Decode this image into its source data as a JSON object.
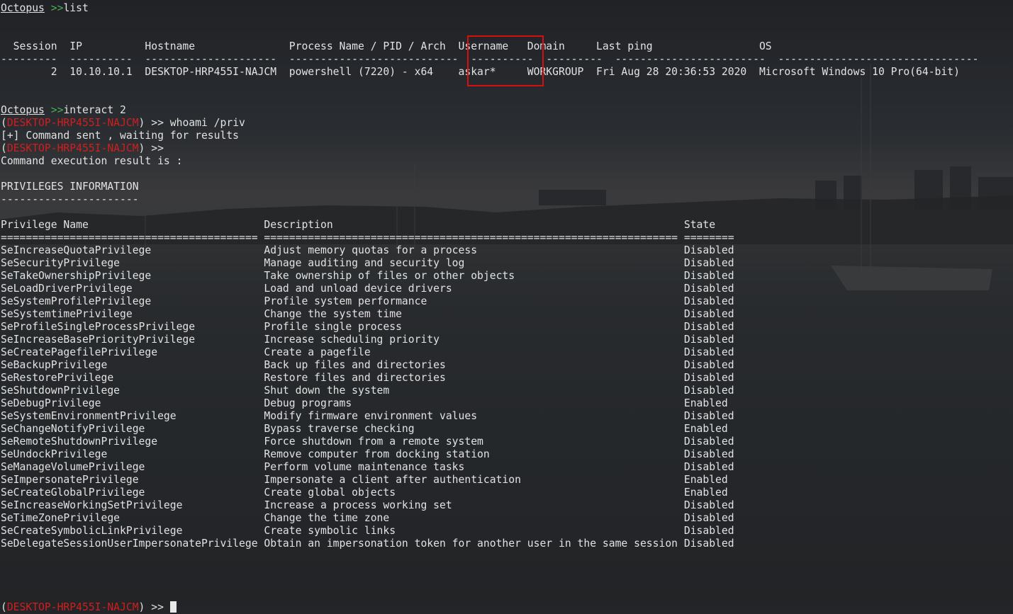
{
  "prompt": {
    "app": "Octopus",
    "arrows": ">>",
    "agent_host": "DESKTOP-HRP455I-NAJCM",
    "agent_arrows": ">>"
  },
  "commands": {
    "list": "list",
    "interact": "interact 2",
    "whoami": "whoami /priv"
  },
  "session_table": {
    "header_line": "  Session  IP          Hostname               Process Name / PID / Arch  Username   Domain     Last ping                 OS",
    "separator_line": "---------  ----------  ---------------------  ---------------------------  ----------  ---------  ------------------------  --------------------------------",
    "row_line": "        2  10.10.10.1  DESKTOP-HRP455I-NAJCM  powershell (7220) - x64    askar*     WORKGROUP  Fri Aug 28 20:36:53 2020  Microsoft Windows 10 Pro(64-bit)"
  },
  "messages": {
    "sent": "[+] Command sent , waiting for results",
    "result": "Command execution result is :"
  },
  "privileges": {
    "heading": "PRIVILEGES INFORMATION",
    "heading_rule": "----------------------",
    "col_header_line": "Privilege Name                            Description                                                        State",
    "eq_rule_line": "========================================= ================================================================== ========",
    "rows": [
      "SeIncreaseQuotaPrivilege                  Adjust memory quotas for a process                                 Disabled",
      "SeSecurityPrivilege                       Manage auditing and security log                                   Disabled",
      "SeTakeOwnershipPrivilege                  Take ownership of files or other objects                           Disabled",
      "SeLoadDriverPrivilege                     Load and unload device drivers                                     Disabled",
      "SeSystemProfilePrivilege                  Profile system performance                                         Disabled",
      "SeSystemtimePrivilege                     Change the system time                                             Disabled",
      "SeProfileSingleProcessPrivilege           Profile single process                                             Disabled",
      "SeIncreaseBasePriorityPrivilege           Increase scheduling priority                                       Disabled",
      "SeCreatePagefilePrivilege                 Create a pagefile                                                  Disabled",
      "SeBackupPrivilege                         Back up files and directories                                      Disabled",
      "SeRestorePrivilege                        Restore files and directories                                      Disabled",
      "SeShutdownPrivilege                       Shut down the system                                               Disabled",
      "SeDebugPrivilege                          Debug programs                                                     Enabled",
      "SeSystemEnvironmentPrivilege              Modify firmware environment values                                 Disabled",
      "SeChangeNotifyPrivilege                   Bypass traverse checking                                           Enabled",
      "SeRemoteShutdownPrivilege                 Force shutdown from a remote system                                Disabled",
      "SeUndockPrivilege                         Remove computer from docking station                               Disabled",
      "SeManageVolumePrivilege                   Perform volume maintenance tasks                                   Disabled",
      "SeImpersonatePrivilege                    Impersonate a client after authentication                          Enabled",
      "SeCreateGlobalPrivilege                   Create global objects                                              Enabled",
      "SeIncreaseWorkingSetPrivilege             Increase a process working set                                     Disabled",
      "SeTimeZonePrivilege                       Change the time zone                                               Disabled",
      "SeCreateSymbolicLinkPrivilege             Create symbolic links                                              Disabled",
      "SeDelegateSessionUserImpersonatePrivilege Obtain an impersonation token for another user in the same session Disabled"
    ]
  },
  "colors": {
    "background": "#232529",
    "text": "#e2e2e2",
    "prompt_green": "#4caf50",
    "host_red": "#d11e1e",
    "highlight_box": "#d41010"
  }
}
